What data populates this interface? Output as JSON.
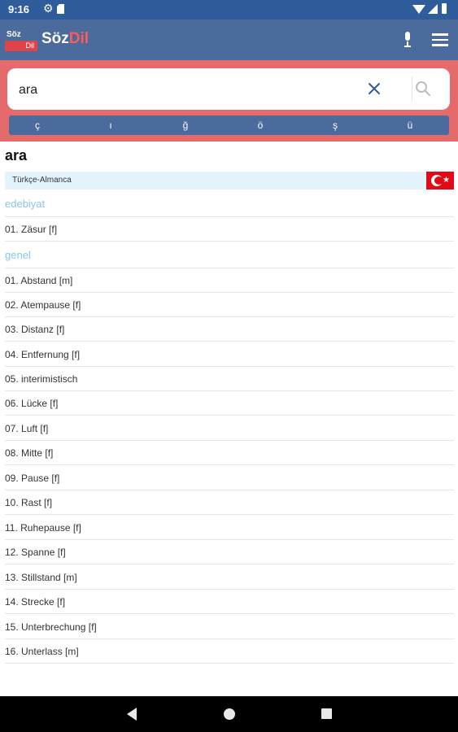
{
  "status_bar": {
    "time": "9:16"
  },
  "app_bar": {
    "logo_top": "Söz",
    "logo_bottom": "Dil",
    "title_a": "Söz",
    "title_b": "Dil"
  },
  "search": {
    "value": "ara",
    "special_chars": [
      "ç",
      "ı",
      "ğ",
      "ö",
      "ş",
      "ü"
    ]
  },
  "result": {
    "word": "ara",
    "language_pair": "Türkçe-Almanca",
    "categories": [
      {
        "name": "edebiyat",
        "entries": [
          "01. Zäsur [f]"
        ]
      },
      {
        "name": "genel",
        "entries": [
          "01. Abstand [m]",
          "02. Atempause [f]",
          "03. Distanz [f]",
          "04. Entfernung [f]",
          "05. interimistisch",
          "06. Lücke [f]",
          "07. Luft [f]",
          "08. Mitte [f]",
          "09. Pause [f]",
          "10. Rast [f]",
          "11. Ruhepause [f]",
          "12. Spanne [f]",
          "13. Stillstand [m]",
          "14. Strecke [f]",
          "15. Unterbrechung [f]",
          "16. Unterlass [m]"
        ]
      }
    ]
  },
  "colors": {
    "appbar": "#4a6b9b",
    "statusbar": "#2f5c9a",
    "search_area": "#e46a6b",
    "category_text": "#8cc4ea",
    "lang_bar": "#e4f4fd",
    "flag_red": "#e30a17"
  },
  "icons": [
    "settings-icon",
    "sd-card-icon",
    "wifi-icon",
    "signal-icon",
    "battery-icon",
    "mic-icon",
    "menu-icon",
    "clear-icon",
    "search-icon",
    "turkey-flag-icon",
    "back-icon",
    "home-icon",
    "recents-icon"
  ]
}
